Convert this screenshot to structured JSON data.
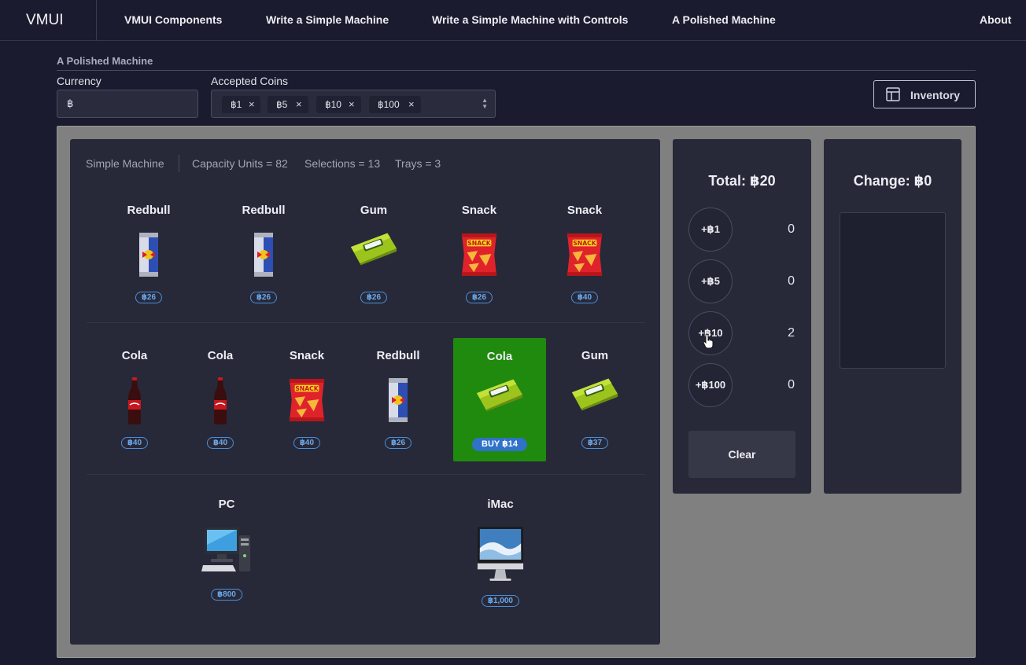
{
  "nav": {
    "brand": "VMUI",
    "links": [
      "VMUI Components",
      "Write a Simple Machine",
      "Write a Simple Machine with Controls",
      "A Polished Machine",
      "About"
    ]
  },
  "header": {
    "title": "A Polished Machine",
    "currency_label": "Currency",
    "currency_value": "฿",
    "coins_label": "Accepted Coins",
    "coins": [
      "฿1",
      "฿5",
      "฿10",
      "฿100"
    ],
    "chip_remove": "×",
    "inventory_label": "Inventory"
  },
  "machine": {
    "name": "Simple Machine",
    "capacity": "Capacity Units = 82",
    "selections": "Selections = 13",
    "trays": "Trays = 3",
    "tray1": [
      {
        "name": "Redbull",
        "price": "฿26",
        "icon": "redbull-can"
      },
      {
        "name": "Redbull",
        "price": "฿26",
        "icon": "redbull-can"
      },
      {
        "name": "Gum",
        "price": "฿26",
        "icon": "gum-pack"
      },
      {
        "name": "Snack",
        "price": "฿26",
        "icon": "snack-bag"
      },
      {
        "name": "Snack",
        "price": "฿40",
        "icon": "snack-bag"
      }
    ],
    "tray2": [
      {
        "name": "Cola",
        "price": "฿40",
        "icon": "cola-bottle"
      },
      {
        "name": "Cola",
        "price": "฿40",
        "icon": "cola-bottle"
      },
      {
        "name": "Snack",
        "price": "฿40",
        "icon": "snack-bag"
      },
      {
        "name": "Redbull",
        "price": "฿26",
        "icon": "redbull-can"
      },
      {
        "name": "Cola",
        "price": "BUY ฿14",
        "icon": "gum-pack",
        "selected": true
      },
      {
        "name": "Gum",
        "price": "฿37",
        "icon": "gum-pack"
      }
    ],
    "tray3": [
      {
        "name": "PC",
        "price": "฿800",
        "icon": "desktop-pc"
      },
      {
        "name": "iMac",
        "price": "฿1,000",
        "icon": "imac"
      }
    ]
  },
  "payment": {
    "total": "Total: ฿20",
    "coins": [
      {
        "label": "+฿1",
        "count": "0"
      },
      {
        "label": "+฿5",
        "count": "0"
      },
      {
        "label": "+฿10",
        "count": "2"
      },
      {
        "label": "+฿100",
        "count": "0"
      }
    ],
    "clear_label": "Clear"
  },
  "change": {
    "title": "Change: ฿0"
  },
  "colors": {
    "page_bg": "#1a1b2e",
    "panel_bg": "#272939",
    "stage_bg": "#808080",
    "selected_green": "#1f8a0e",
    "price_blue": "#4b8fd8"
  }
}
